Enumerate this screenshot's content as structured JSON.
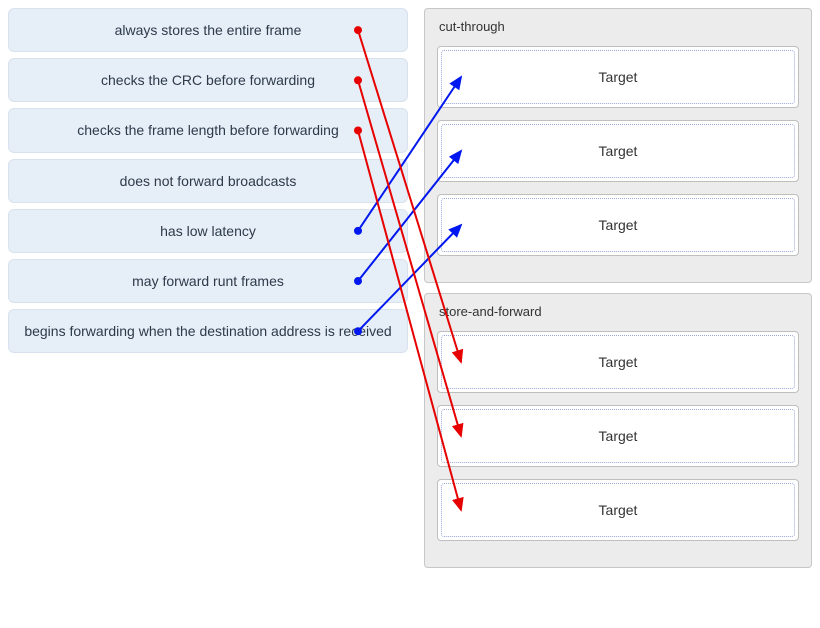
{
  "sources": [
    {
      "id": "s1",
      "label": "always stores the entire frame"
    },
    {
      "id": "s2",
      "label": "checks the CRC before forwarding"
    },
    {
      "id": "s3",
      "label": "checks the frame length before forwarding"
    },
    {
      "id": "s4",
      "label": "does not forward broadcasts"
    },
    {
      "id": "s5",
      "label": "has low latency"
    },
    {
      "id": "s6",
      "label": "may forward runt frames"
    },
    {
      "id": "s7",
      "label": "begins forwarding when the destination address is received"
    }
  ],
  "groups": [
    {
      "id": "cut-through",
      "title": "cut-through",
      "slots": 3
    },
    {
      "id": "store-and-forward",
      "title": "store-and-forward",
      "slots": 3
    }
  ],
  "target_placeholder": "Target",
  "arrows": [
    {
      "from": "s5",
      "to_group": "cut-through",
      "to_slot": 0,
      "color": "blue"
    },
    {
      "from": "s6",
      "to_group": "cut-through",
      "to_slot": 1,
      "color": "blue"
    },
    {
      "from": "s7",
      "to_group": "cut-through",
      "to_slot": 2,
      "color": "blue"
    },
    {
      "from": "s1",
      "to_group": "store-and-forward",
      "to_slot": 0,
      "color": "red"
    },
    {
      "from": "s2",
      "to_group": "store-and-forward",
      "to_slot": 1,
      "color": "red"
    },
    {
      "from": "s3",
      "to_group": "store-and-forward",
      "to_slot": 2,
      "color": "red"
    }
  ],
  "colors": {
    "blue": "#0017ef",
    "red": "#e60000"
  }
}
